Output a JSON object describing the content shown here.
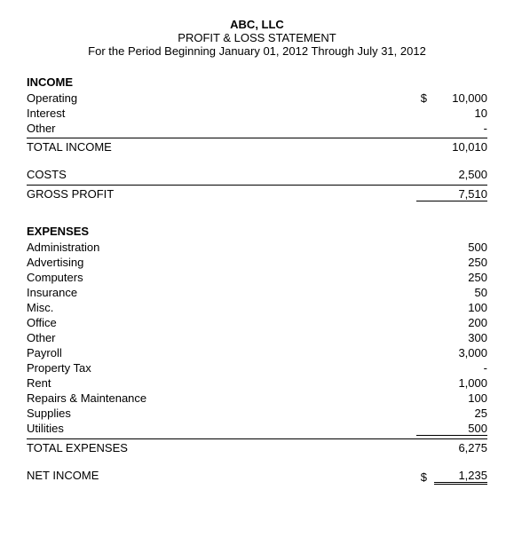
{
  "header": {
    "company": "ABC, LLC",
    "title": "PROFIT & LOSS STATEMENT",
    "period": "For the Period Beginning January 01, 2012 Through  July 31, 2012"
  },
  "income": {
    "label": "INCOME",
    "items": [
      {
        "label": "Operating",
        "dollar": "$",
        "amount": "10,000"
      },
      {
        "label": "Interest",
        "dollar": "",
        "amount": "10"
      },
      {
        "label": "Other",
        "dollar": "",
        "amount": "-"
      }
    ],
    "total_label": "TOTAL INCOME",
    "total_amount": "10,010"
  },
  "costs": {
    "label": "COSTS",
    "amount": "2,500"
  },
  "gross_profit": {
    "label": "GROSS PROFIT",
    "amount": "7,510"
  },
  "expenses": {
    "label": "EXPENSES",
    "items": [
      {
        "label": "Administration",
        "amount": "500"
      },
      {
        "label": "Advertising",
        "amount": "250"
      },
      {
        "label": "Computers",
        "amount": "250"
      },
      {
        "label": "Insurance",
        "amount": "50"
      },
      {
        "label": "Misc.",
        "amount": "100"
      },
      {
        "label": "Office",
        "amount": "200"
      },
      {
        "label": "Other",
        "amount": "300"
      },
      {
        "label": "Payroll",
        "amount": "3,000"
      },
      {
        "label": "Property Tax",
        "amount": "-"
      },
      {
        "label": "Rent",
        "amount": "1,000"
      },
      {
        "label": "Repairs & Maintenance",
        "amount": "100"
      },
      {
        "label": "Supplies",
        "amount": "25"
      },
      {
        "label": "Utilities",
        "amount": "500"
      }
    ],
    "total_label": "TOTAL EXPENSES",
    "total_amount": "6,275"
  },
  "net_income": {
    "label": "NET INCOME",
    "dollar": "$",
    "amount": "1,235"
  }
}
